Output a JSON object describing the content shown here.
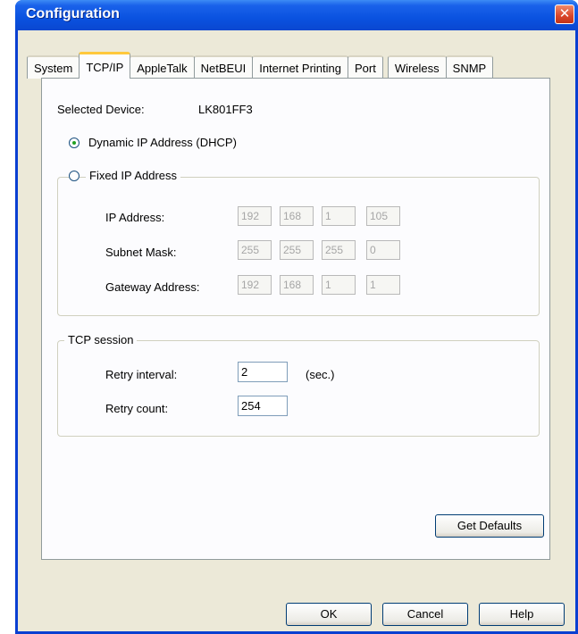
{
  "window": {
    "title": "Configuration",
    "close_glyph": "✕"
  },
  "tabs": [
    {
      "label": "System"
    },
    {
      "label": "TCP/IP"
    },
    {
      "label": "AppleTalk"
    },
    {
      "label": "NetBEUI"
    },
    {
      "label": "Internet Printing"
    },
    {
      "label": "Port"
    },
    {
      "label": "Wireless"
    },
    {
      "label": "SNMP"
    }
  ],
  "device": {
    "label": "Selected Device:",
    "value": "LK801FF3"
  },
  "ip_mode": {
    "dhcp_label": "Dynamic IP Address (DHCP)",
    "fixed_label": "Fixed IP Address",
    "selected": "dhcp"
  },
  "fixed_ip": {
    "ip_label": "IP Address:",
    "ip": [
      "192",
      "168",
      "1",
      "105"
    ],
    "subnet_label": "Subnet Mask:",
    "subnet": [
      "255",
      "255",
      "255",
      "0"
    ],
    "gateway_label": "Gateway Address:",
    "gateway": [
      "192",
      "168",
      "1",
      "1"
    ]
  },
  "tcp": {
    "group_label": "TCP session",
    "retry_interval_label": "Retry interval:",
    "retry_interval": "2",
    "retry_interval_unit": "(sec.)",
    "retry_count_label": "Retry count:",
    "retry_count": "254"
  },
  "buttons": {
    "get_defaults": "Get Defaults",
    "ok": "OK",
    "cancel": "Cancel",
    "help": "Help"
  }
}
